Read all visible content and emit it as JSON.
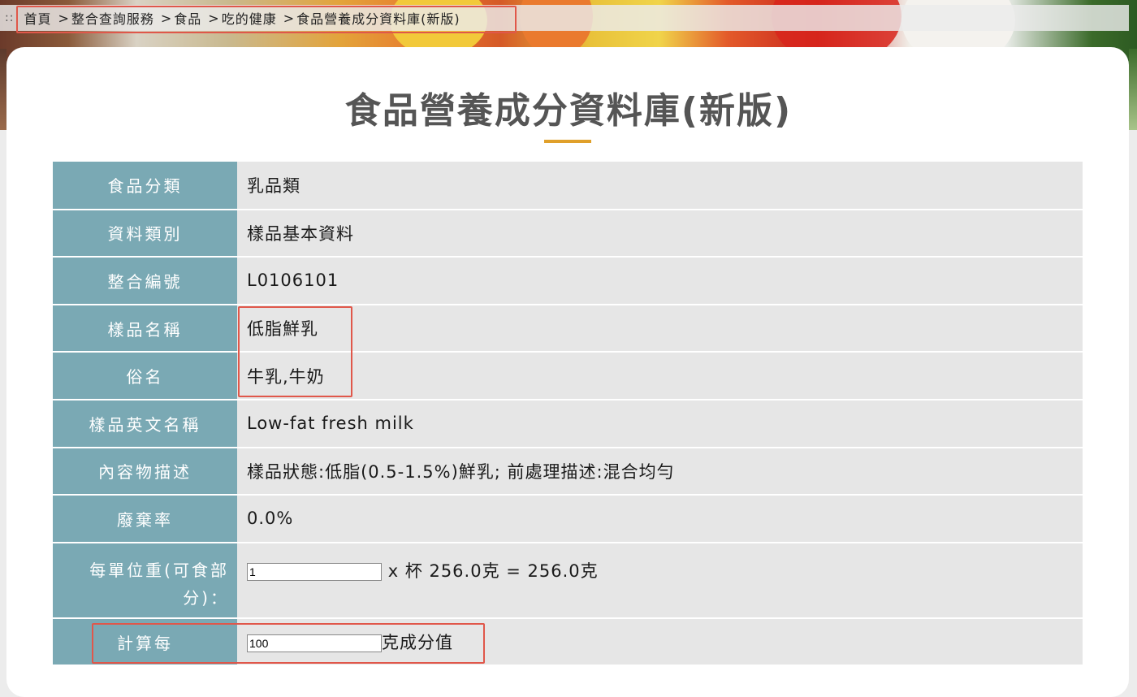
{
  "breadcrumb": {
    "lead": "::",
    "items": [
      "首頁",
      "整合查詢服務",
      "食品",
      "吃的健康",
      "食品營養成分資料庫(新版)"
    ]
  },
  "page": {
    "title": "食品營養成分資料庫(新版)"
  },
  "rows": {
    "category": {
      "label": "食品分類",
      "value": "乳品類"
    },
    "data_type": {
      "label": "資料類別",
      "value": "樣品基本資料"
    },
    "id": {
      "label": "整合編號",
      "value": "L0106101"
    },
    "sample_name": {
      "label": "樣品名稱",
      "value": "低脂鮮乳"
    },
    "common_name": {
      "label": "俗名",
      "value": "牛乳,牛奶"
    },
    "english_name": {
      "label": "樣品英文名稱",
      "value": "Low-fat fresh milk"
    },
    "description": {
      "label": "內容物描述",
      "value": "樣品狀態:低脂(0.5-1.5%)鮮乳; 前處理描述:混合均勻"
    },
    "waste_rate": {
      "label": "廢棄率",
      "value": "0.0%"
    },
    "unit_weight": {
      "label_line1": "每單位重(可食部",
      "label_line2": "分)：",
      "input_value": "1",
      "suffix": "x 杯 256.0克 = 256.0克"
    },
    "calc_per": {
      "label": "計算每",
      "input_value": "100",
      "suffix": "克成分值"
    }
  },
  "colors": {
    "header_cell": "#7aa9b4",
    "value_cell": "#e6e6e6",
    "accent_underline": "#e0a02a",
    "highlight_box": "#e0574a"
  }
}
